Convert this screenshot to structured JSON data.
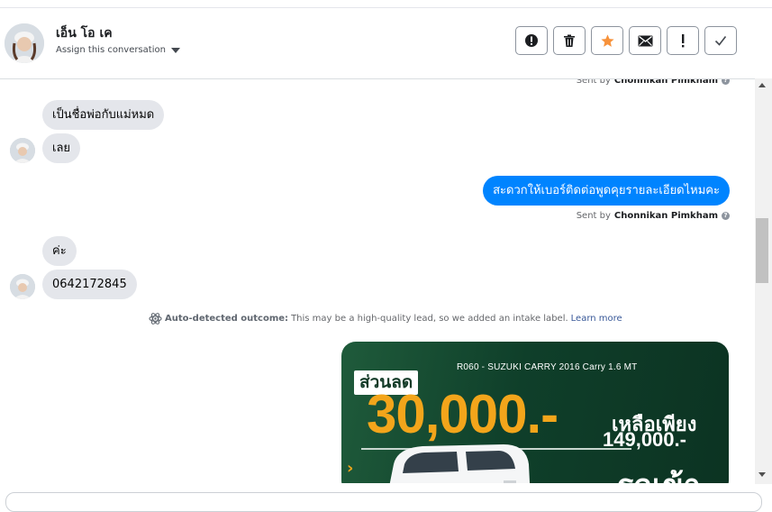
{
  "header": {
    "contact_name": "เอ็น โอ เค",
    "assign_label": "Assign this conversation",
    "actions": [
      {
        "name": "mark-spam-button",
        "icon": "exclamation-circle-icon"
      },
      {
        "name": "delete-button",
        "icon": "trash-icon"
      },
      {
        "name": "star-button",
        "icon": "star-icon"
      },
      {
        "name": "mark-unread-button",
        "icon": "envelope-icon"
      },
      {
        "name": "follow-up-button",
        "icon": "exclamation-icon"
      },
      {
        "name": "mark-done-button",
        "icon": "checkmark-icon"
      }
    ]
  },
  "colors": {
    "accent": "#0084ff",
    "star": "#f7923b",
    "incoming_bubble": "#e4e6eb",
    "ad_orange": "#f3a51b",
    "ad_green": "#1f5b3b"
  },
  "conversation": {
    "sent_by_prefix": "Sent by",
    "sent_by_name": "Chonnikan Pimkham",
    "messages": [
      {
        "direction": "in",
        "text": "เป็นชื่อพ่อกับแม่หมด"
      },
      {
        "direction": "in",
        "text": "เลย"
      },
      {
        "direction": "out",
        "text": "สะดวกให้เบอร์ติดต่อพูดคุยรายละเอียดไหมคะ"
      },
      {
        "direction": "in",
        "text": "ค่ะ"
      },
      {
        "direction": "in",
        "text": "0642172845"
      }
    ],
    "outcome": {
      "icon": "atom-icon",
      "label": "Auto-detected outcome:",
      "text": "This may be a high-quality lead, so we added an intake label.",
      "link": "Learn more"
    }
  },
  "ad": {
    "title": "R060 - SUZUKI CARRY 2016 Carry 1.6 MT",
    "discount_label": "ส่วนลด",
    "discount_amount": "30,000.-",
    "only_label": "เหลือเพียง",
    "price": "149,000.-",
    "tail_text": "รถเข้า"
  }
}
